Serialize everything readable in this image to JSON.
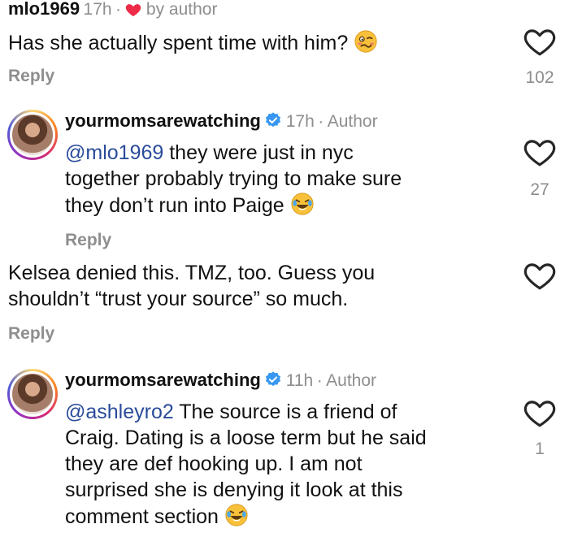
{
  "comments": [
    {
      "username": "mlo1969",
      "time": "17h",
      "separator": "·",
      "liked_by_author": "by author",
      "text": "Has she actually spent time with him?",
      "reply_label": "Reply",
      "likes": "102"
    },
    {
      "username": "yourmomsarewatching",
      "time": "17h",
      "separator": "·",
      "badge": "Author",
      "mention": "@mlo1969",
      "text_lines": [
        "they were just in nyc",
        "together probably trying to make sure",
        "they don’t run into Paige"
      ],
      "reply_label": "Reply",
      "likes": "27"
    },
    {
      "text_lines": [
        "Kelsea denied this. TMZ, too. Guess you",
        "shouldn’t “trust your source” so much."
      ],
      "reply_label": "Reply"
    },
    {
      "username": "yourmomsarewatching",
      "time": "11h",
      "separator": "·",
      "badge": "Author",
      "mention": "@ashleyro2",
      "text_lines": [
        "The source is a friend of",
        "Craig.  Dating is a loose term but he said",
        "they are def hooking up. I am not",
        "surprised she is denying it look at this",
        "comment section"
      ],
      "likes": "1"
    }
  ],
  "icons": {
    "heart": "heart-outline-icon",
    "liked_heart": "heart-filled-icon",
    "verified": "verified-badge-icon",
    "woozy": "woozy-face-emoji",
    "laughing": "tears-of-joy-emoji"
  },
  "colors": {
    "liked_heart": "#ed2a47",
    "verified": "#3897f0",
    "mention": "#2a4b9b",
    "meta": "#8e8e8e"
  }
}
